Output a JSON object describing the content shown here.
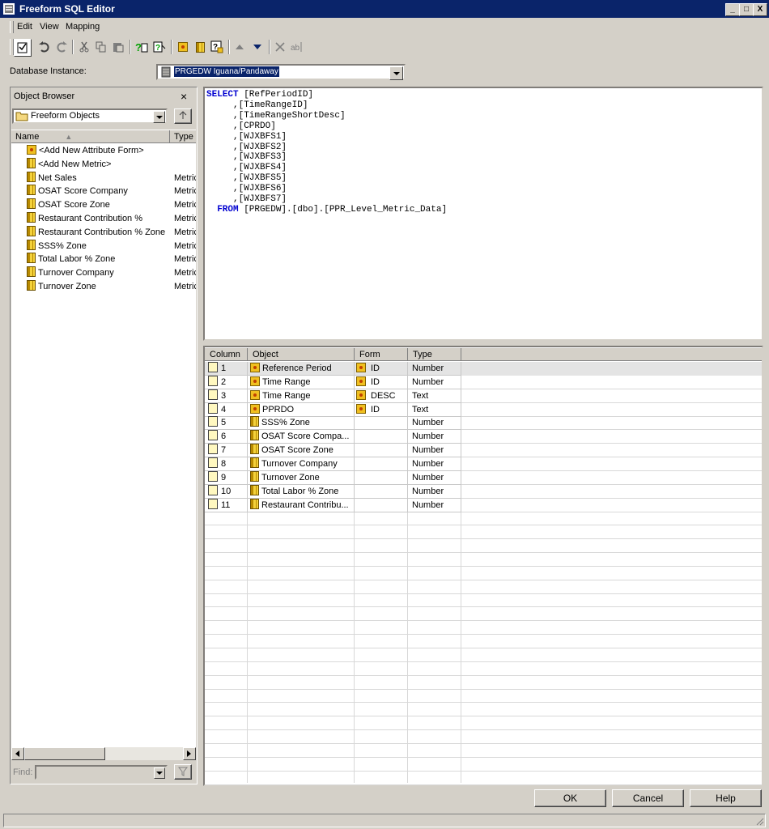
{
  "window": {
    "title": "Freeform SQL Editor",
    "min": "_",
    "max": "□",
    "close": "X"
  },
  "menu": [
    {
      "label": "Edit"
    },
    {
      "label": "View"
    },
    {
      "label": "Mapping"
    }
  ],
  "db_instance": {
    "label": "Database Instance:",
    "value": "PRGEDW Iguana/Pandaway"
  },
  "object_browser": {
    "title": "Object Browser",
    "close": "×",
    "folder": "Freeform Objects",
    "columns": {
      "name": "Name",
      "type": "Type"
    },
    "items": [
      {
        "name": "<Add New Attribute Form>",
        "type": "",
        "icon": "attribute-icon"
      },
      {
        "name": "<Add New Metric>",
        "type": "",
        "icon": "metric-icon"
      },
      {
        "name": "Net Sales",
        "type": "Metric",
        "icon": "metric-icon"
      },
      {
        "name": "OSAT Score Company",
        "type": "Metric",
        "icon": "metric-icon"
      },
      {
        "name": "OSAT Score Zone",
        "type": "Metric",
        "icon": "metric-icon"
      },
      {
        "name": "Restaurant Contribution %",
        "type": "Metric",
        "icon": "metric-icon"
      },
      {
        "name": "Restaurant Contribution % Zone",
        "type": "Metric",
        "icon": "metric-icon"
      },
      {
        "name": "SSS% Zone",
        "type": "Metric",
        "icon": "metric-icon"
      },
      {
        "name": "Total Labor % Zone",
        "type": "Metric",
        "icon": "metric-icon"
      },
      {
        "name": "Turnover Company",
        "type": "Metric",
        "icon": "metric-icon"
      },
      {
        "name": "Turnover Zone",
        "type": "Metric",
        "icon": "metric-icon"
      }
    ],
    "find_label": "Find:"
  },
  "sql": {
    "lines": [
      {
        "kw": "SELECT",
        "text": " [RefPeriodID]"
      },
      {
        "kw": "",
        "text": "     ,[TimeRangeID]"
      },
      {
        "kw": "",
        "text": "     ,[TimeRangeShortDesc]"
      },
      {
        "kw": "",
        "text": "     ,[CPRDO]"
      },
      {
        "kw": "",
        "text": "     ,[WJXBFS1]"
      },
      {
        "kw": "",
        "text": "     ,[WJXBFS2]"
      },
      {
        "kw": "",
        "text": "     ,[WJXBFS3]"
      },
      {
        "kw": "",
        "text": "     ,[WJXBFS4]"
      },
      {
        "kw": "",
        "text": "     ,[WJXBFS5]"
      },
      {
        "kw": "",
        "text": "     ,[WJXBFS6]"
      },
      {
        "kw": "",
        "text": "     ,[WJXBFS7]"
      },
      {
        "kw": "  FROM",
        "text": " [PRGEDW].[dbo].[PPR_Level_Metric_Data]"
      }
    ]
  },
  "mapping_grid": {
    "headers": {
      "column": "Column",
      "object": "Object",
      "form": "Form",
      "type": "Type"
    },
    "rows": [
      {
        "col": "1",
        "object": "Reference Period",
        "obj_icon": "attribute-icon",
        "form": "ID",
        "type": "Number"
      },
      {
        "col": "2",
        "object": "Time Range",
        "obj_icon": "attribute-icon",
        "form": "ID",
        "type": "Number"
      },
      {
        "col": "3",
        "object": "Time Range",
        "obj_icon": "attribute-icon",
        "form": "DESC",
        "type": "Text"
      },
      {
        "col": "4",
        "object": "PPRDO",
        "obj_icon": "attribute-icon",
        "form": "ID",
        "type": "Text"
      },
      {
        "col": "5",
        "object": "SSS% Zone",
        "obj_icon": "metric-icon",
        "form": "",
        "type": "Number"
      },
      {
        "col": "6",
        "object": "OSAT Score Compa...",
        "obj_icon": "metric-icon",
        "form": "",
        "type": "Number"
      },
      {
        "col": "7",
        "object": "OSAT Score Zone",
        "obj_icon": "metric-icon",
        "form": "",
        "type": "Number"
      },
      {
        "col": "8",
        "object": "Turnover Company",
        "obj_icon": "metric-icon",
        "form": "",
        "type": "Number"
      },
      {
        "col": "9",
        "object": "Turnover Zone",
        "obj_icon": "metric-icon",
        "form": "",
        "type": "Number"
      },
      {
        "col": "10",
        "object": "Total Labor % Zone",
        "obj_icon": "metric-icon",
        "form": "",
        "type": "Number"
      },
      {
        "col": "11",
        "object": "Restaurant Contribu...",
        "obj_icon": "metric-icon",
        "form": "",
        "type": "Number"
      }
    ]
  },
  "buttons": {
    "ok": "OK",
    "cancel": "Cancel",
    "help": "Help"
  },
  "colors": {
    "titlebar": "#0a246a",
    "selection": "#0a246a",
    "sql_keyword": "#0000d0",
    "window_bg": "#d4d0c8"
  }
}
